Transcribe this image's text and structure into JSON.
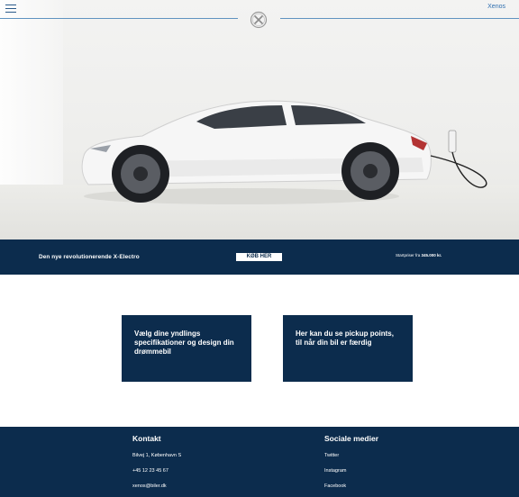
{
  "header": {
    "menu_icon": "hamburger-icon",
    "brand_link": "Xenos",
    "logo_icon": "xenos-circle-x-logo"
  },
  "hero": {
    "image": "white electric car charging"
  },
  "banner": {
    "title": "Den nye revolutionerende X-Electro",
    "button_label": "KØB HER",
    "price_prefix": "Startpriser fra",
    "price_value": "345.000 kr."
  },
  "cards": [
    {
      "text": "Vælg dine yndlings specifikationer og design din drømmebil"
    },
    {
      "text": "Her kan du se pickup points, til når din bil er færdig"
    }
  ],
  "footer": {
    "contact": {
      "title": "Kontakt",
      "items": [
        "Bilvej 1, København S",
        "+45 12 23 45 67",
        "xenos@biler.dk"
      ]
    },
    "social": {
      "title": "Sociale medier",
      "items": [
        "Twitter",
        "Instagram",
        "Facebook"
      ]
    }
  },
  "colors": {
    "navy": "#0c2c4d",
    "link_blue": "#2f6fb0",
    "white": "#ffffff"
  }
}
